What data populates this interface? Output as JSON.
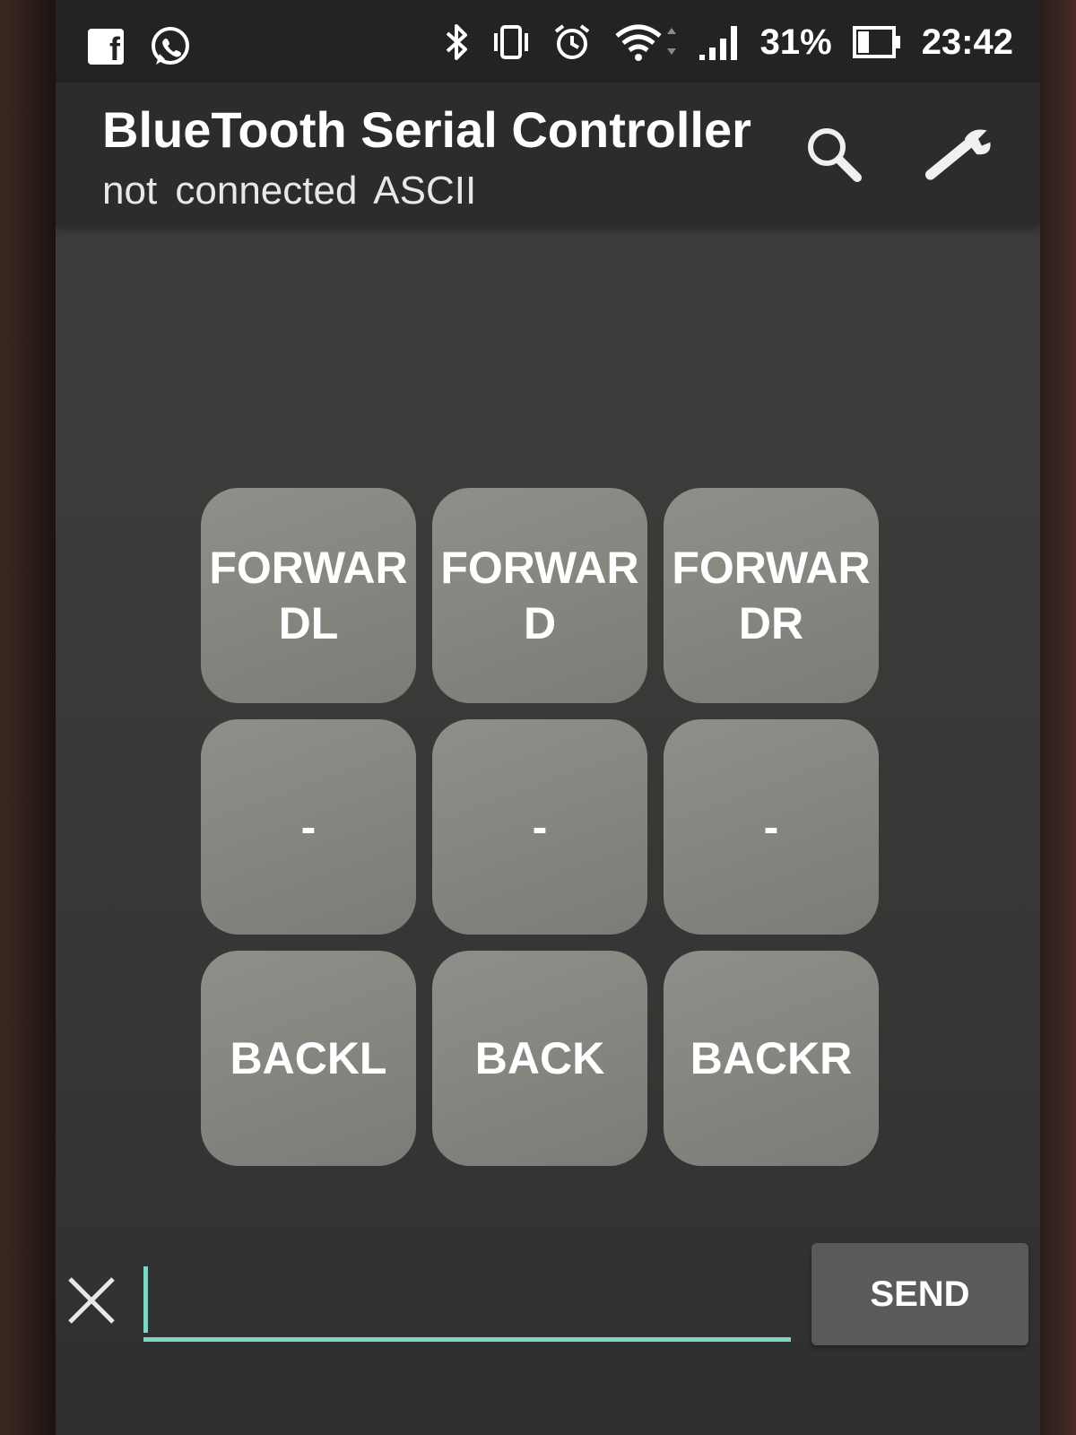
{
  "status_bar": {
    "battery_percent": "31%",
    "time": "23:42",
    "left_icons": [
      "facebook-icon",
      "whatsapp-icon"
    ],
    "right_icons": [
      "bluetooth-icon",
      "vibrate-icon",
      "alarm-icon",
      "wifi-icon",
      "signal-icon",
      "battery-icon"
    ]
  },
  "app_bar": {
    "title": "BlueTooth Serial Controller",
    "connection_status": "not connected",
    "mode": "ASCII",
    "actions": [
      "search-icon",
      "wrench-icon"
    ]
  },
  "pad": {
    "buttons": [
      {
        "label": "FORWARDL"
      },
      {
        "label": "FORWARD"
      },
      {
        "label": "FORWARDR"
      },
      {
        "label": "-"
      },
      {
        "label": "-"
      },
      {
        "label": "-"
      },
      {
        "label": "BACKL"
      },
      {
        "label": "BACK"
      },
      {
        "label": "BACKR"
      }
    ]
  },
  "composer": {
    "input_value": "",
    "send_label": "SEND",
    "clear_icon": "close-icon"
  },
  "colors": {
    "accent": "#7fd6c2",
    "button_bg": "#868781",
    "app_bar_bg": "#2c2c2b"
  }
}
